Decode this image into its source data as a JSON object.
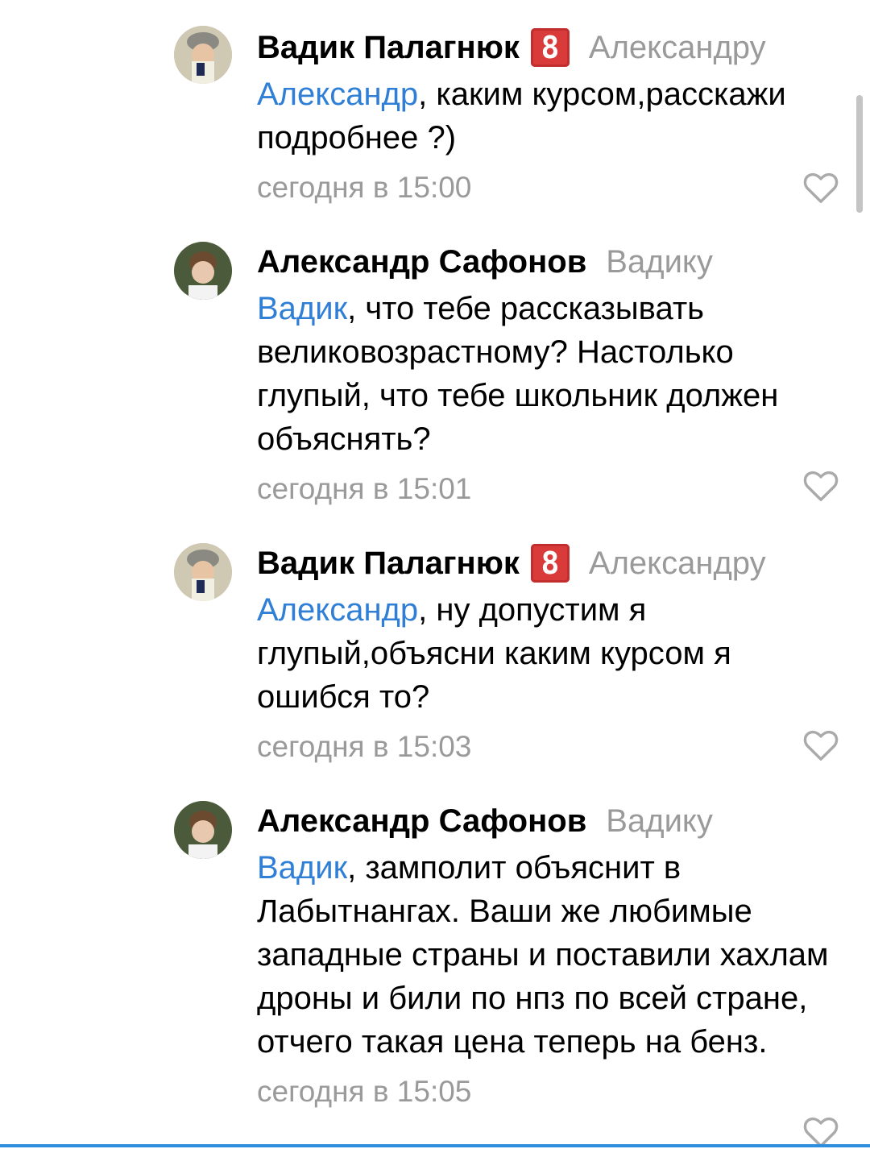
{
  "comments": [
    {
      "author": "Вадик Палагнюк",
      "badge": "8",
      "reply_to": "Александру",
      "mention": "Александр",
      "text": ", каким курсом,расскажи подробнее ?)",
      "time": "сегодня в 15:00"
    },
    {
      "author": "Александр Сафонов",
      "reply_to": "Вадику",
      "mention": "Вадик",
      "text": ", что тебе рассказывать великовозрастному? Настолько глупый, что тебе школьник должен объяснять?",
      "time": "сегодня в 15:01"
    },
    {
      "author": "Вадик Палагнюк",
      "badge": "8",
      "reply_to": "Александру",
      "mention": "Александр",
      "text": ", ну допустим я глупый,объясни каким курсом я ошибся то?",
      "time": "сегодня в 15:03"
    },
    {
      "author": "Александр Сафонов",
      "reply_to": "Вадику",
      "mention": "Вадик",
      "text": ", замполит объяснит в Лабытнангах. Ваши же любимые западные страны и поставили хахлам дроны и били по нпз по всей стране, отчего такая цена теперь на бенз.",
      "time": "сегодня в 15:05"
    }
  ],
  "colors": {
    "mention": "#2f7fd6",
    "muted": "#9a9a9a",
    "badge": "#d93b3b"
  },
  "icons": {
    "like": "heart-outline-icon"
  }
}
